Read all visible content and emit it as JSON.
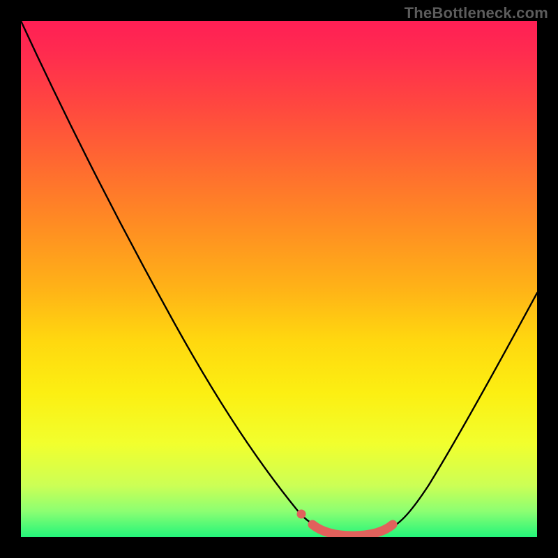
{
  "watermark": "TheBottleneck.com",
  "chart_data": {
    "type": "line",
    "title": "",
    "xlabel": "",
    "ylabel": "",
    "xlim": [
      0,
      100
    ],
    "ylim": [
      0,
      100
    ],
    "grid": false,
    "legend": false,
    "series": [
      {
        "name": "bottleneck-curve",
        "x": [
          0,
          10,
          20,
          30,
          40,
          50,
          55,
          60,
          65,
          70,
          72,
          80,
          90,
          100
        ],
        "y": [
          100,
          84,
          68,
          52,
          36,
          20,
          12,
          5,
          2,
          1,
          2,
          12,
          28,
          50
        ]
      },
      {
        "name": "highlight-valley",
        "x": [
          55,
          58,
          62,
          66,
          70,
          72
        ],
        "y": [
          2.5,
          1.5,
          1,
          1,
          1.5,
          2.5
        ]
      },
      {
        "name": "highlight-dot",
        "x": [
          53
        ],
        "y": [
          4
        ]
      }
    ],
    "colors": {
      "curve": "#000000",
      "highlight": "#e1615c"
    },
    "background_gradient": {
      "top": "#ff1f55",
      "bottom": "#23f57a"
    }
  }
}
